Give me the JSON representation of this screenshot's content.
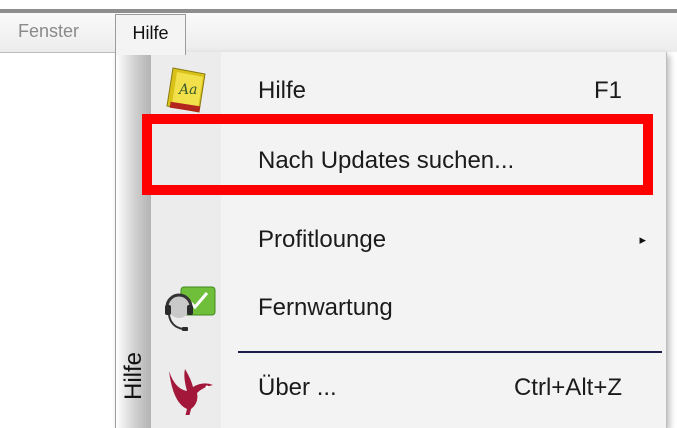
{
  "menubar": {
    "items": [
      {
        "label": "Fenster"
      },
      {
        "label": "Hilfe"
      }
    ]
  },
  "dropdown": {
    "sidebar_label": "Hilfe",
    "items": [
      {
        "label": "Hilfe",
        "shortcut": "F1",
        "icon": "help-book-icon"
      },
      {
        "label": "Nach Updates suchen...",
        "shortcut": "",
        "icon": ""
      },
      {
        "label": "Profitlounge",
        "submenu_arrow": "▸",
        "icon": ""
      },
      {
        "label": "Fernwartung",
        "shortcut": "",
        "icon": "remote-support-headset-icon"
      },
      {
        "label": "Über ...",
        "shortcut": "Ctrl+Alt+Z",
        "icon": "about-bird-icon"
      }
    ]
  },
  "highlight_color": "#ff0000"
}
